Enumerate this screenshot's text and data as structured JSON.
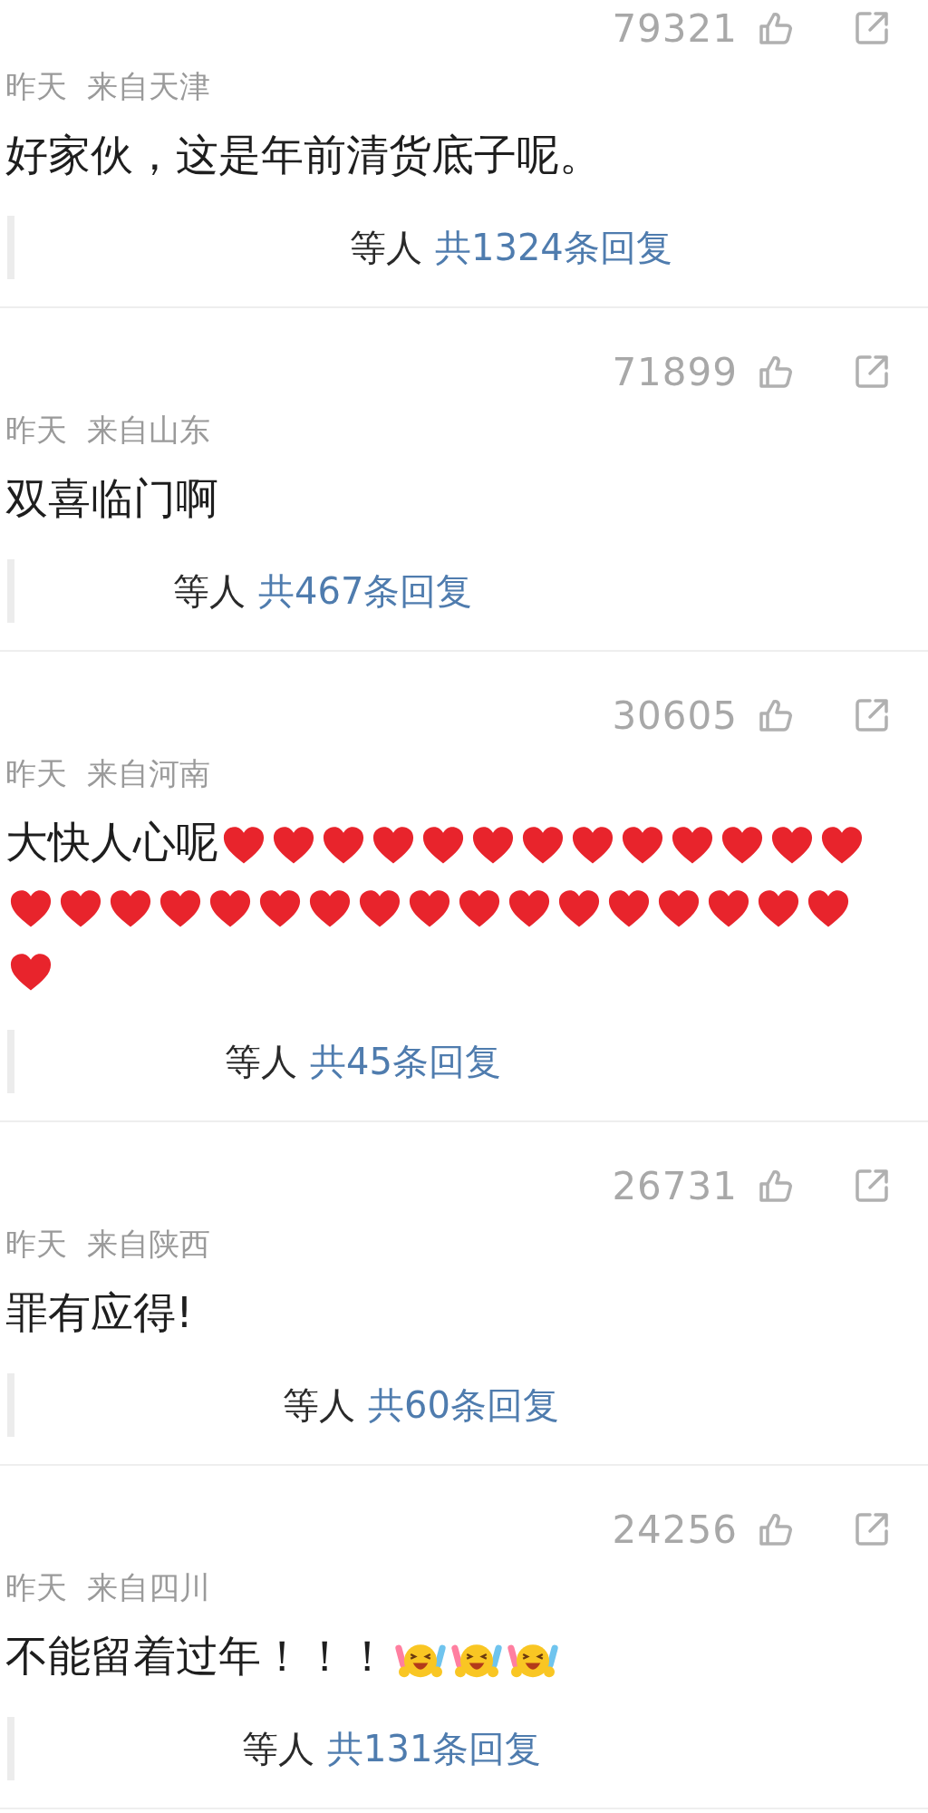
{
  "comments": [
    {
      "likes": "79321",
      "time": "昨天",
      "location": "来自天津",
      "text": "好家伙，这是年前清货底子呢。",
      "reply_prefix": "等人",
      "reply_count": "共1324条回复"
    },
    {
      "likes": "71899",
      "time": "昨天",
      "location": "来自山东",
      "text": "双喜临门啊",
      "reply_prefix": "等人",
      "reply_count": "共467条回复"
    },
    {
      "likes": "30605",
      "time": "昨天",
      "location": "来自河南",
      "text": "大快人心呢",
      "emojis": [
        {
          "kind": "heart"
        },
        {
          "kind": "heart"
        },
        {
          "kind": "heart"
        },
        {
          "kind": "heart"
        },
        {
          "kind": "heart"
        },
        {
          "kind": "heart"
        },
        {
          "kind": "heart"
        },
        {
          "kind": "heart"
        },
        {
          "kind": "heart"
        },
        {
          "kind": "heart"
        },
        {
          "kind": "heart"
        },
        {
          "kind": "heart"
        },
        {
          "kind": "heart"
        },
        {
          "kind": "heart"
        },
        {
          "kind": "heart"
        },
        {
          "kind": "heart"
        },
        {
          "kind": "heart"
        },
        {
          "kind": "heart"
        },
        {
          "kind": "heart"
        },
        {
          "kind": "heart"
        },
        {
          "kind": "heart"
        },
        {
          "kind": "heart"
        },
        {
          "kind": "heart"
        },
        {
          "kind": "heart"
        },
        {
          "kind": "heart"
        },
        {
          "kind": "heart"
        },
        {
          "kind": "heart"
        },
        {
          "kind": "heart"
        },
        {
          "kind": "heart"
        },
        {
          "kind": "heart"
        },
        {
          "kind": "heart"
        }
      ],
      "reply_prefix": "等人",
      "reply_count": "共45条回复"
    },
    {
      "likes": "26731",
      "time": "昨天",
      "location": "来自陕西",
      "text": "罪有应得!",
      "reply_prefix": "等人",
      "reply_count": "共60条回复"
    },
    {
      "likes": "24256",
      "time": "昨天",
      "location": "来自四川",
      "text": "不能留着过年！！！",
      "emojis": [
        {
          "kind": "cheer"
        },
        {
          "kind": "cheer"
        },
        {
          "kind": "cheer"
        }
      ],
      "reply_prefix": "等人",
      "reply_count": "共131条回复"
    }
  ]
}
